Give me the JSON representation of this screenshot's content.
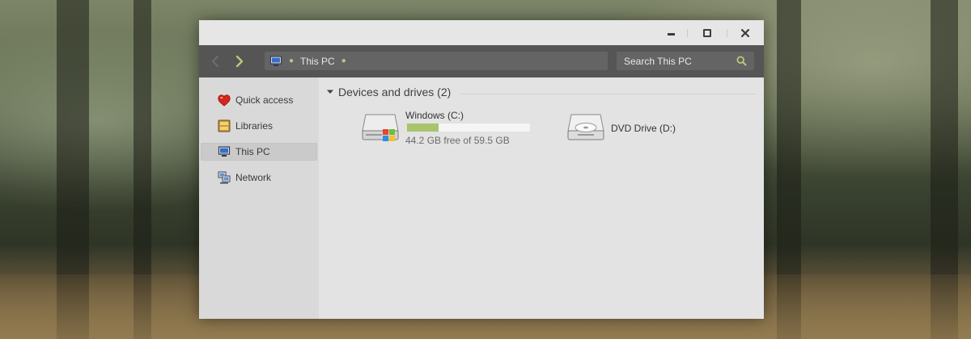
{
  "window": {
    "minimize_icon": "minimize-icon",
    "maximize_icon": "maximize-icon",
    "close_icon": "close-icon"
  },
  "navbar": {
    "back_icon": "back-arrow-icon",
    "forward_icon": "forward-arrow-icon",
    "address": {
      "icon": "this-pc-icon",
      "crumb": "This PC"
    },
    "search": {
      "placeholder": "Search This PC",
      "icon": "search-icon"
    }
  },
  "sidebar": {
    "items": [
      {
        "label": "Quick access",
        "icon": "heart-icon"
      },
      {
        "label": "Libraries",
        "icon": "libraries-icon"
      },
      {
        "label": "This PC",
        "icon": "computer-icon",
        "selected": true
      },
      {
        "label": "Network",
        "icon": "network-icon"
      }
    ]
  },
  "content": {
    "group": {
      "title": "Devices and drives (2)",
      "icon": "chevron-down-icon"
    },
    "drives": [
      {
        "name": "Windows (C:)",
        "free_text": "44.2 GB free of 59.5 GB",
        "used_fraction": 0.257,
        "icon": "hard-drive-icon"
      },
      {
        "name": "DVD Drive (D:)",
        "icon": "dvd-drive-icon"
      }
    ]
  },
  "colors": {
    "accent": "#b7c97a",
    "capacity_fill": "#a9c46c",
    "navbar_bg": "#555555",
    "sidebar_bg": "#d9d9d9",
    "content_bg": "#e3e3e3"
  }
}
